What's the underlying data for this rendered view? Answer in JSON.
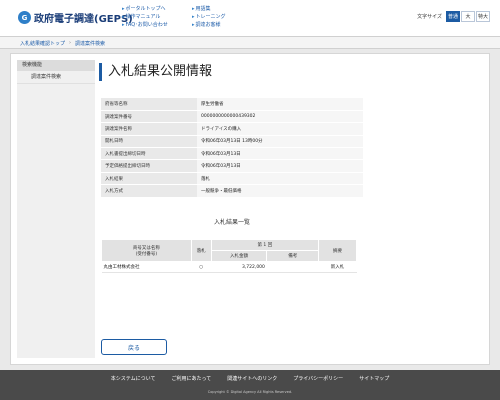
{
  "header": {
    "logo_mark": "G",
    "site_name": "政府電子調達(GEPS)",
    "links_col1": [
      "ポータルトップへ",
      "操作マニュアル",
      "FAQ･お問い合わせ"
    ],
    "links_col2": [
      "用語集",
      "トレーニング",
      "調達お客様"
    ],
    "font_size_label": "文字サイズ",
    "font_sizes": [
      "普通",
      "大",
      "特大"
    ]
  },
  "breadcrumb": [
    "入札結果確認トップ",
    "調達案件検索"
  ],
  "sidebar": {
    "heading": "検索機能",
    "items": [
      "調達案件検索"
    ]
  },
  "page_title": "入札結果公開情報",
  "details": [
    {
      "label": "府省等名称",
      "value": "厚生労働省"
    },
    {
      "label": "調達案件番号",
      "value": "0000000000000439302"
    },
    {
      "label": "調達案件名称",
      "value": "ドライアイスの購入"
    },
    {
      "label": "開札日時",
      "value": "令和06年03月13日 13時00分"
    },
    {
      "label": "入札書提出締切日時",
      "value": "令和06年03月13日"
    },
    {
      "label": "予定価格提出締切日時",
      "value": "令和06年03月13日"
    },
    {
      "label": "入札結果",
      "value": "落札"
    },
    {
      "label": "入札方式",
      "value": "一般競争・最低価格"
    }
  ],
  "result_section_title": "入札結果一覧",
  "result_table": {
    "col_company": "商号又は名称\n(受付番号)",
    "col_award": "落札",
    "col_round": "第 1 回",
    "col_amount": "入札金額",
    "col_note": "備考",
    "col_summary": "摘要",
    "rows": [
      {
        "company": "丸由工材株式会社",
        "award": "○",
        "amount": "3,722,000",
        "note": "",
        "summary": "新入札"
      }
    ]
  },
  "back_button": "戻る",
  "footer": {
    "links": [
      "本システムについて",
      "ご利用にあたって",
      "関連サイトへのリンク",
      "プライバシーポリシー",
      "サイトマップ"
    ],
    "copyright": "Copyright © Digital Agency All Rights Reserved."
  },
  "colors": {
    "accent": "#1c5ba3",
    "footer_bg": "#4a4a4a"
  }
}
